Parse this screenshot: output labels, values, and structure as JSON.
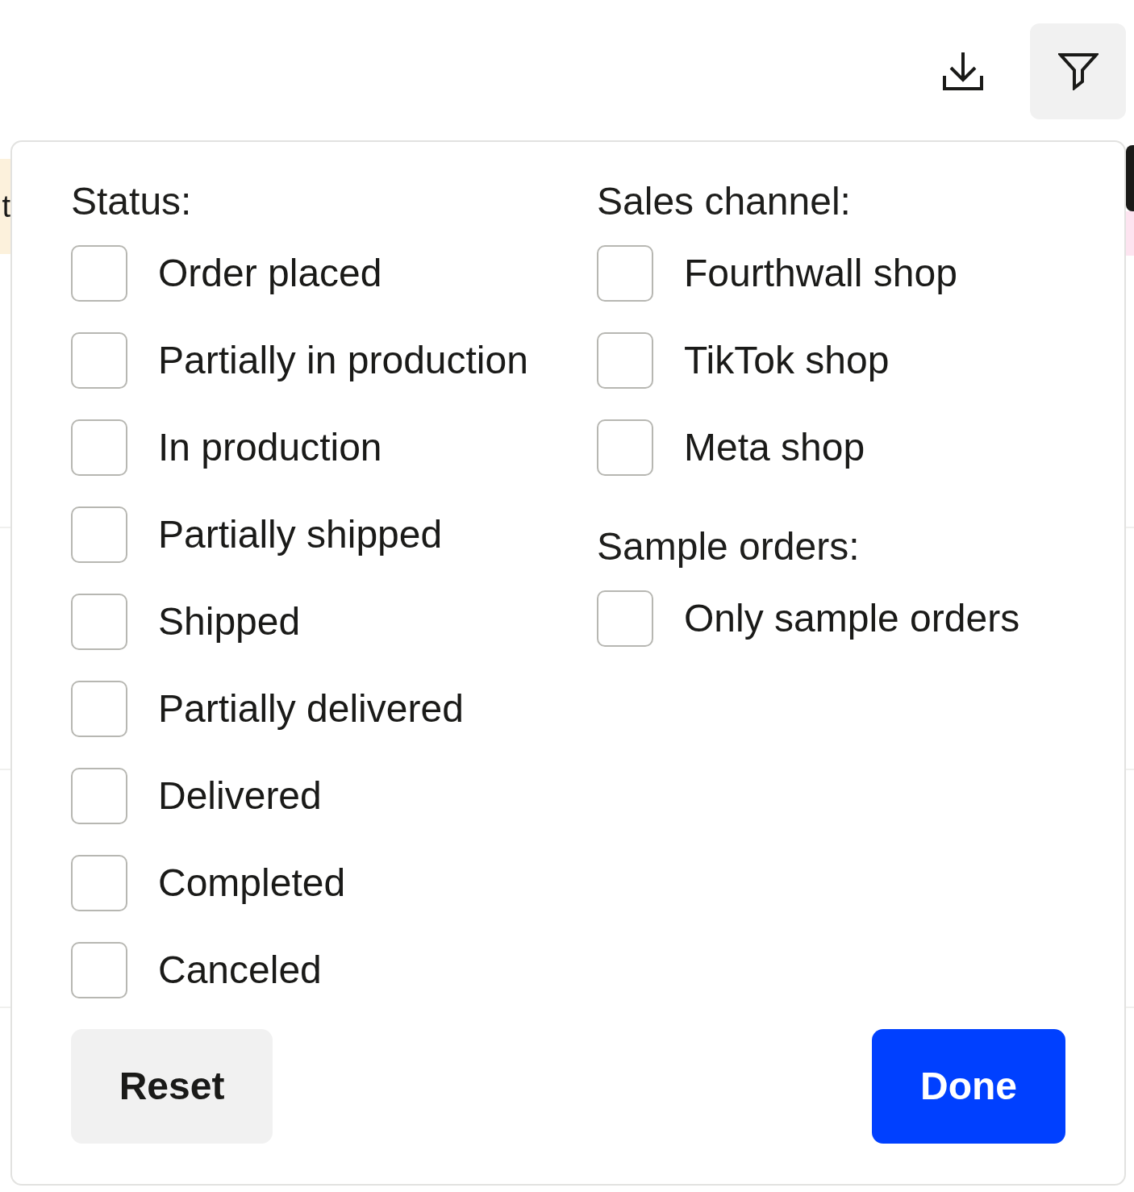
{
  "toolbar": {
    "buttons": [
      {
        "kind": "download",
        "selected": false
      },
      {
        "kind": "filter",
        "selected": true
      }
    ]
  },
  "background": {
    "tag": {
      "text": "t"
    }
  },
  "filter_panel": {
    "groups": [
      {
        "title": "Status:",
        "options": [
          {
            "label": "Order placed",
            "checked": false
          },
          {
            "label": "Partially in production",
            "checked": false
          },
          {
            "label": "In production",
            "checked": false
          },
          {
            "label": "Partially shipped",
            "checked": false
          },
          {
            "label": "Shipped",
            "checked": false
          },
          {
            "label": "Partially delivered",
            "checked": false
          },
          {
            "label": "Delivered",
            "checked": false
          },
          {
            "label": "Completed",
            "checked": false
          },
          {
            "label": "Canceled",
            "checked": false
          }
        ]
      },
      {
        "title": "Sales channel:",
        "options": [
          {
            "label": "Fourthwall shop",
            "checked": false
          },
          {
            "label": "TikTok shop",
            "checked": false
          },
          {
            "label": "Meta shop",
            "checked": false
          }
        ]
      },
      {
        "title": "Sample orders:",
        "options": [
          {
            "label": "Only sample orders",
            "checked": false
          }
        ]
      }
    ],
    "buttons": [
      {
        "label": "Reset",
        "kind": "secondary"
      },
      {
        "label": "Done",
        "kind": "primary"
      }
    ]
  }
}
